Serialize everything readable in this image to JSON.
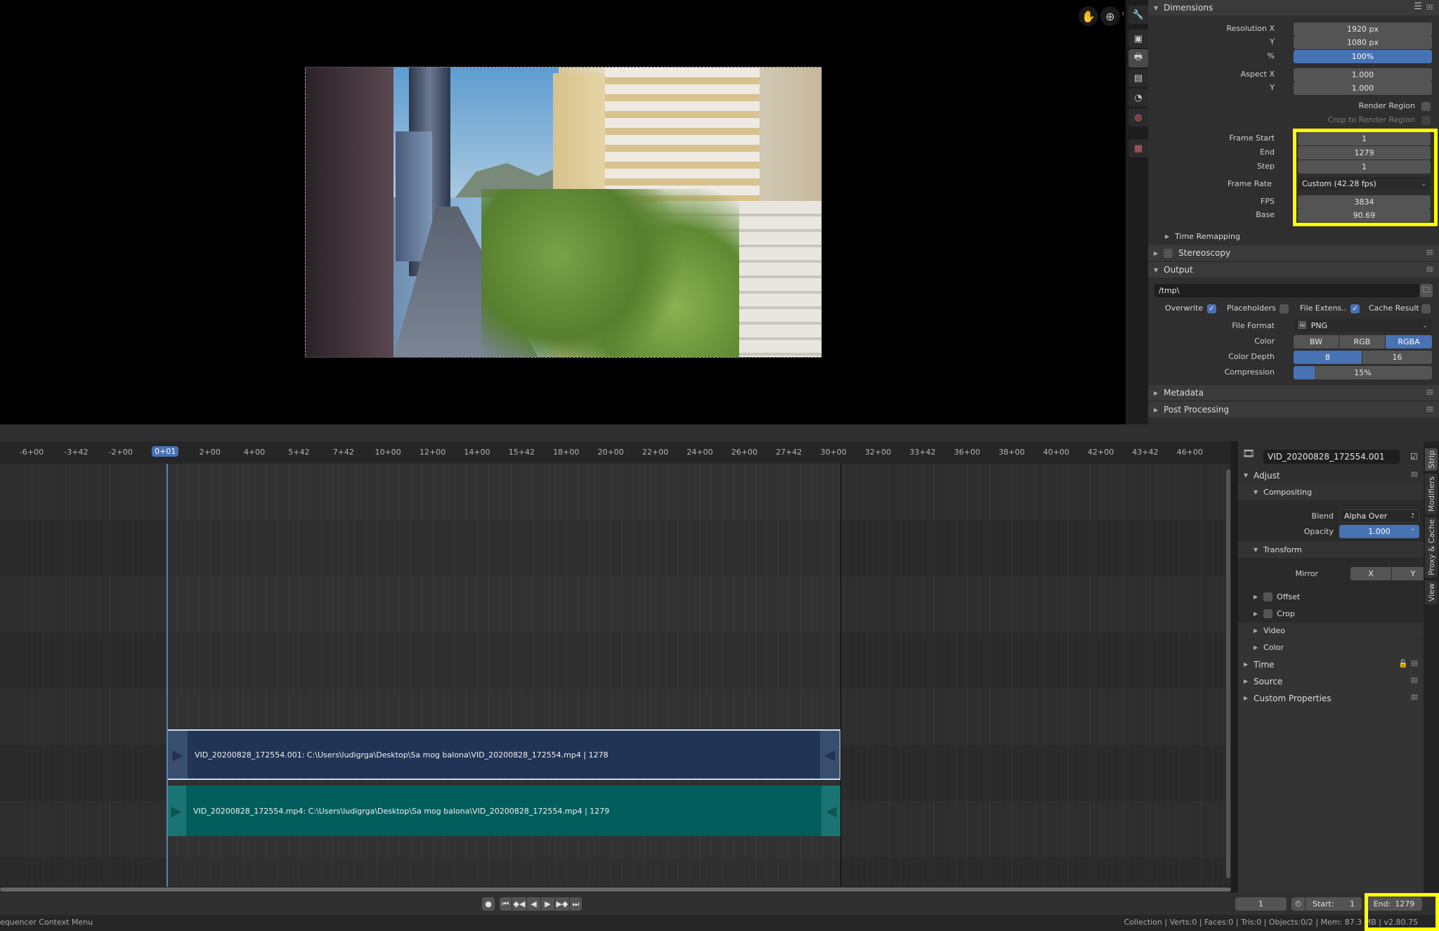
{
  "preview": {
    "nav_icons": [
      "hand-pan-icon",
      "zoom-icon"
    ],
    "image_alt": "City street view with tall buildings and trees"
  },
  "properties_tabs": [
    "tool",
    "render",
    "output",
    "view-layer",
    "scene",
    "world",
    "texture"
  ],
  "properties": {
    "dimensions": {
      "title": "Dimensions",
      "resolution_x_label": "Resolution X",
      "resolution_x": "1920 px",
      "resolution_y_label": "Y",
      "resolution_y": "1080 px",
      "percent_label": "%",
      "percent": "100%",
      "aspect_x_label": "Aspect X",
      "aspect_x": "1.000",
      "aspect_y_label": "Y",
      "aspect_y": "1.000",
      "render_region_label": "Render Region",
      "crop_region_label": "Crop to Render Region",
      "frame_start_label": "Frame Start",
      "frame_start": "1",
      "frame_end_label": "End",
      "frame_end": "1279",
      "step_label": "Step",
      "step": "1",
      "frame_rate_label": "Frame Rate",
      "frame_rate": "Custom (42.28 fps)",
      "fps_label": "FPS",
      "fps": "3834",
      "base_label": "Base",
      "base": "90.69",
      "time_remapping": "Time Remapping"
    },
    "stereoscopy": "Stereoscopy",
    "output": {
      "title": "Output",
      "path": "/tmp\\",
      "overwrite_label": "Overwrite",
      "overwrite": true,
      "placeholders_label": "Placeholders",
      "placeholders": false,
      "file_ext_label": "File Extens..",
      "file_ext": true,
      "cache_result_label": "Cache Result",
      "cache_result": false,
      "file_format_label": "File Format",
      "file_format": "PNG",
      "color_label": "Color",
      "color_options": [
        "BW",
        "RGB",
        "RGBA"
      ],
      "color_selected": "RGBA",
      "color_depth_label": "Color Depth",
      "color_depth_options": [
        "8",
        "16"
      ],
      "color_depth_selected": "8",
      "compression_label": "Compression",
      "compression": "15%",
      "compression_fraction": 0.15
    },
    "metadata": "Metadata",
    "post_processing": "Post Processing"
  },
  "timeline": {
    "ticks": [
      "-6+00",
      "-3+42",
      "-2+00",
      "0+01",
      "2+00",
      "4+00",
      "5+42",
      "7+42",
      "10+00",
      "12+00",
      "14+00",
      "15+42",
      "18+00",
      "20+00",
      "22+00",
      "24+00",
      "26+00",
      "27+42",
      "30+00",
      "32+00",
      "33+42",
      "36+00",
      "38+00",
      "40+00",
      "42+00",
      "43+42",
      "46+00"
    ],
    "current": "0+01",
    "strips": [
      {
        "name": "VID_20200828_172554.001",
        "label": "VID_20200828_172554.001: C:\\Users\\ludigrga\\Desktop\\Sa mog balona\\VID_20200828_172554.mp4 | 1278",
        "type": "meta",
        "selected": true
      },
      {
        "name": "VID_20200828_172554.mp4",
        "label": "VID_20200828_172554.mp4: C:\\Users\\ludigrga\\Desktop\\Sa mog balona\\VID_20200828_172554.mp4 | 1279",
        "type": "movie",
        "selected": false
      }
    ]
  },
  "sidebar": {
    "strip_name": "VID_20200828_172554.001",
    "tabs": [
      "Strip",
      "Modifiers",
      "Proxy & Cache",
      "View"
    ],
    "active_tab": "Strip",
    "adjust": "Adjust",
    "compositing": "Compositing",
    "blend_label": "Blend",
    "blend": "Alpha Over",
    "opacity_label": "Opacity",
    "opacity": "1.000",
    "transform": "Transform",
    "mirror_label": "Mirror",
    "mirror_x": "X",
    "mirror_y": "Y",
    "offset": "Offset",
    "crop": "Crop",
    "video": "Video",
    "color": "Color",
    "time": "Time",
    "source": "Source",
    "custom_properties": "Custom Properties"
  },
  "playback": {
    "current_frame": "1",
    "start_label": "Start:",
    "start": "1",
    "end_label": "End:",
    "end": "1279"
  },
  "status": {
    "left": "equencer Context Menu",
    "right": "Collection | Verts:0 | Faces:0 | Tris:0 | Objects:0/2 | Mem: 87.3 MB | v2.80.75"
  },
  "colors": {
    "accent": "#4772b3",
    "highlight_box": "#ffff00",
    "meta_strip": "#213456",
    "movie_strip": "#025e5c"
  }
}
